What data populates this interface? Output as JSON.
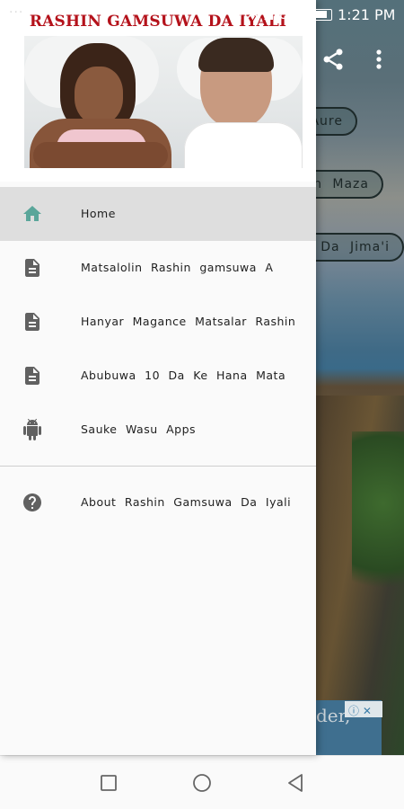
{
  "status_bar": {
    "dots": "···",
    "battery_percent": "82%",
    "time": "1:21 PM"
  },
  "background_app": {
    "chips": [
      "Aure",
      "in  Maza",
      "a  Da  Jima'i"
    ],
    "ad_text": "der,",
    "ad_badge": "ⓘ ✕"
  },
  "drawer": {
    "header_title": "RASHIN GAMSUWA DA IYALI",
    "header_image": "couple-in-bed-photo",
    "items": [
      {
        "label": "Home",
        "icon": "home-icon",
        "active": true
      },
      {
        "label": "Matsalolin  Rashin  gamsuwa  A",
        "icon": "document-icon",
        "active": false
      },
      {
        "label": "Hanyar  Magance  Matsalar  Rashin",
        "icon": "document-icon",
        "active": false
      },
      {
        "label": "Abubuwa  10  Da  Ke  Hana  Mata",
        "icon": "document-icon",
        "active": false
      },
      {
        "label": "Sauke  Wasu  Apps",
        "icon": "android-icon",
        "active": false
      }
    ],
    "secondary_items": [
      {
        "label": "About  Rashin  Gamsuwa  Da  Iyali",
        "icon": "help-icon"
      }
    ]
  },
  "colors": {
    "header_title": "#b4121b",
    "active_icon": "#5aa69a",
    "icon_gray": "#616161",
    "active_row": "#dedede"
  },
  "nav_bar": {
    "buttons": [
      "recents-button",
      "home-button",
      "back-button"
    ]
  }
}
